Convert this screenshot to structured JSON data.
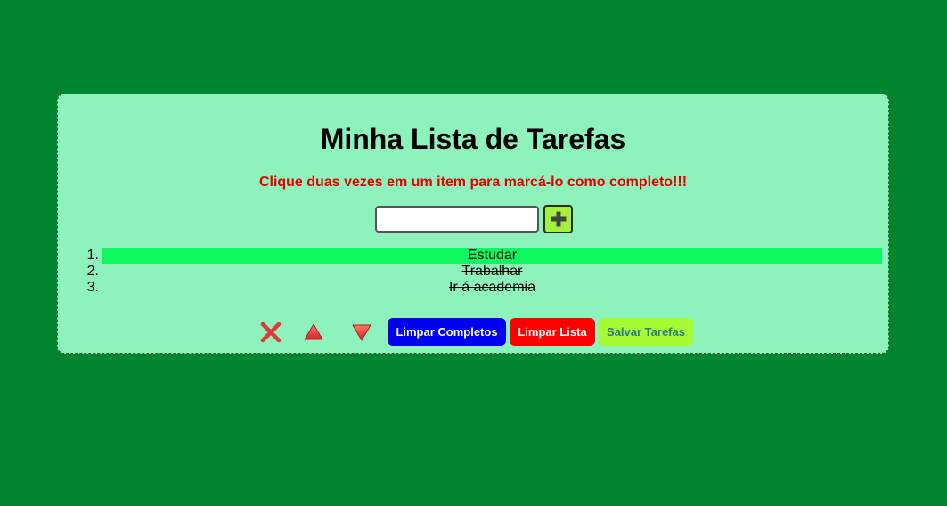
{
  "title": "Minha Lista de Tarefas",
  "hint": "Clique duas vezes em um item para marcá-lo como completo!!!",
  "input": {
    "value": "",
    "placeholder": ""
  },
  "add_button_icon": "plus-icon",
  "tasks": [
    {
      "number": "1.",
      "text": "Estudar",
      "completed": false,
      "selected": true
    },
    {
      "number": "2.",
      "text": "Trabalhar",
      "completed": true,
      "selected": false
    },
    {
      "number": "3.",
      "text": "Ir á academia",
      "completed": true,
      "selected": false
    }
  ],
  "toolbar": {
    "remove_icon": "red-x-icon",
    "move_up_icon": "red-triangle-up-icon",
    "move_down_icon": "red-triangle-down-icon",
    "clear_completed_label": "Limpar Completos",
    "clear_list_label": "Limpar Lista",
    "save_label": "Salvar Tarefas"
  },
  "colors": {
    "page_background": "#00852f",
    "card_background": "#8df2bb",
    "hint_text": "#e20000",
    "selected_row": "#0ff75f",
    "clear_completed_button": "#0000f0",
    "clear_list_button": "#ff0000",
    "save_button": "#a6fb33",
    "add_button": "#a4f03a"
  }
}
